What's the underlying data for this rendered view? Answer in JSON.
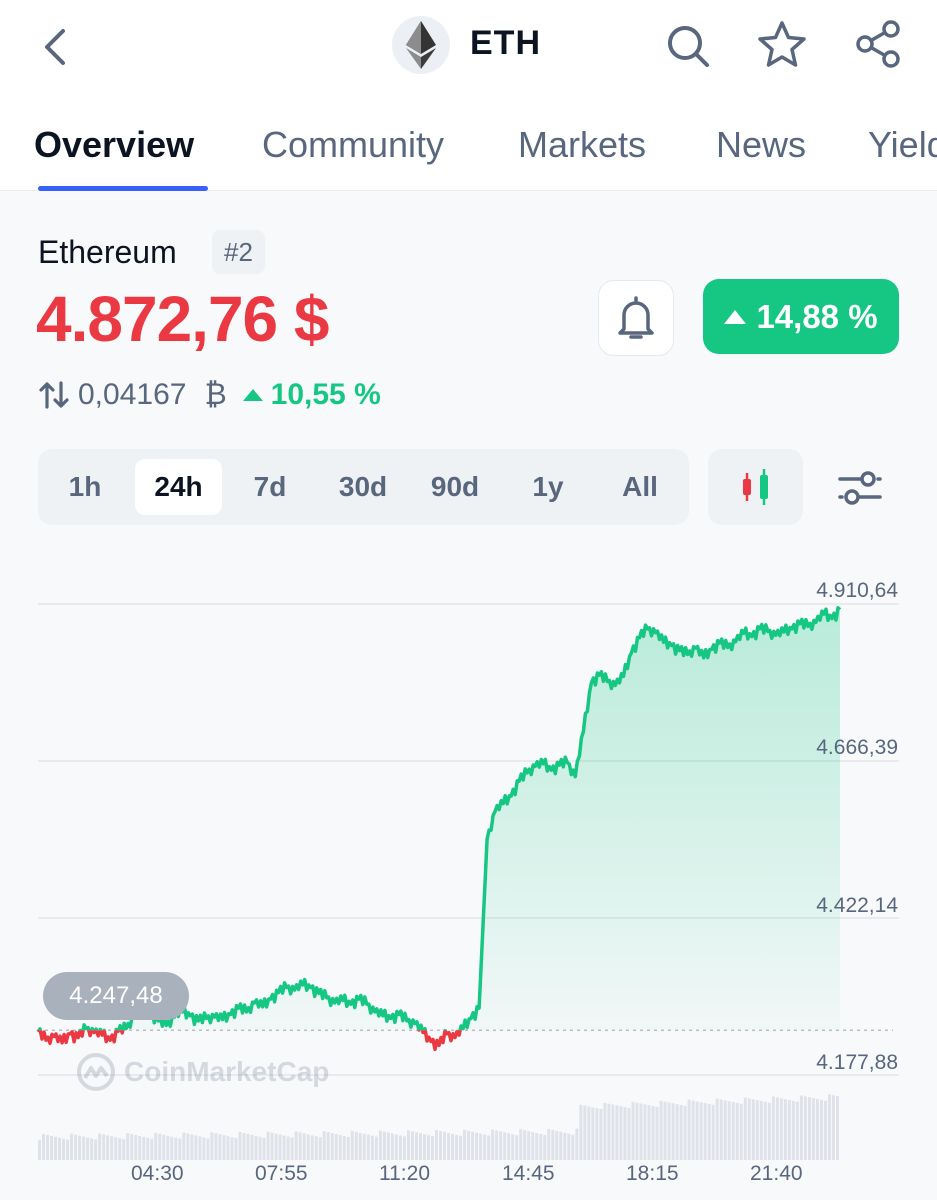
{
  "header": {
    "symbol": "ETH",
    "icons": [
      "back-icon",
      "ethereum-logo",
      "search-icon",
      "star-icon",
      "share-icon"
    ]
  },
  "tabs": [
    {
      "label": "Overview",
      "active": true
    },
    {
      "label": "Community",
      "active": false
    },
    {
      "label": "Markets",
      "active": false
    },
    {
      "label": "News",
      "active": false
    },
    {
      "label": "Yield",
      "active": false
    }
  ],
  "coin": {
    "name": "Ethereum",
    "rank": "#2",
    "price": "4.872,76 $",
    "change_24h": "14,88 %",
    "btc_value": "0,04167",
    "btc_symbol": "₿",
    "btc_change": "10,55 %"
  },
  "ranges": {
    "options": [
      "1h",
      "24h",
      "7d",
      "30d",
      "90d",
      "1y",
      "All"
    ],
    "selected": "24h"
  },
  "colors": {
    "up": "#16c784",
    "down": "#ea3943",
    "accent": "#3861fb"
  },
  "chart_data": {
    "type": "line",
    "y_ticks": [
      "4.910,64",
      "4.666,39",
      "4.422,14",
      "4.177,88"
    ],
    "x_ticks": [
      "04:30",
      "07:55",
      "11:20",
      "14:45",
      "18:15",
      "21:40"
    ],
    "ylim": [
      4177.88,
      4910.64
    ],
    "baseline": 4247.48,
    "baseline_label": "4.247,48",
    "watermark": "CoinMarketCap",
    "series": [
      {
        "x": [
          0,
          1,
          2,
          3,
          4,
          5,
          6,
          7,
          8,
          9,
          10,
          11,
          12,
          13,
          14,
          15,
          16,
          17,
          18,
          19,
          20,
          21,
          22,
          23,
          24,
          25,
          26,
          27,
          28,
          29,
          30,
          31,
          32,
          33,
          34,
          35,
          36,
          37,
          38,
          39,
          40,
          41,
          42,
          43,
          44,
          45,
          46,
          47,
          48,
          49,
          50,
          51,
          52,
          53,
          54,
          55,
          56,
          57,
          58,
          59,
          60,
          61,
          62,
          63,
          64,
          65,
          66,
          67,
          68,
          69,
          70,
          71,
          72,
          73,
          74,
          75,
          76,
          77,
          78,
          79,
          80,
          81,
          82,
          83,
          84,
          85,
          86,
          87,
          88,
          89,
          90,
          91,
          92,
          93,
          94,
          95,
          96,
          97,
          98,
          99,
          100
        ],
        "values": [
          4245,
          4232,
          4238,
          4228,
          4242,
          4236,
          4250,
          4244,
          4240,
          4232,
          4246,
          4250,
          4270,
          4280,
          4275,
          4262,
          4255,
          4268,
          4276,
          4270,
          4262,
          4266,
          4268,
          4264,
          4272,
          4282,
          4276,
          4290,
          4284,
          4296,
          4306,
          4314,
          4310,
          4318,
          4314,
          4305,
          4298,
          4290,
          4294,
          4288,
          4296,
          4288,
          4276,
          4270,
          4266,
          4272,
          4262,
          4258,
          4244,
          4230,
          4224,
          4242,
          4236,
          4250,
          4266,
          4282,
          4545,
          4588,
          4600,
          4612,
          4635,
          4648,
          4658,
          4662,
          4652,
          4660,
          4664,
          4642,
          4712,
          4788,
          4800,
          4790,
          4784,
          4798,
          4835,
          4858,
          4872,
          4866,
          4851,
          4846,
          4838,
          4832,
          4842,
          4827,
          4840,
          4850,
          4843,
          4852,
          4865,
          4860,
          4872,
          4868,
          4862,
          4867,
          4872,
          4880,
          4876,
          4882,
          4895,
          4888,
          4902
        ]
      }
    ]
  }
}
